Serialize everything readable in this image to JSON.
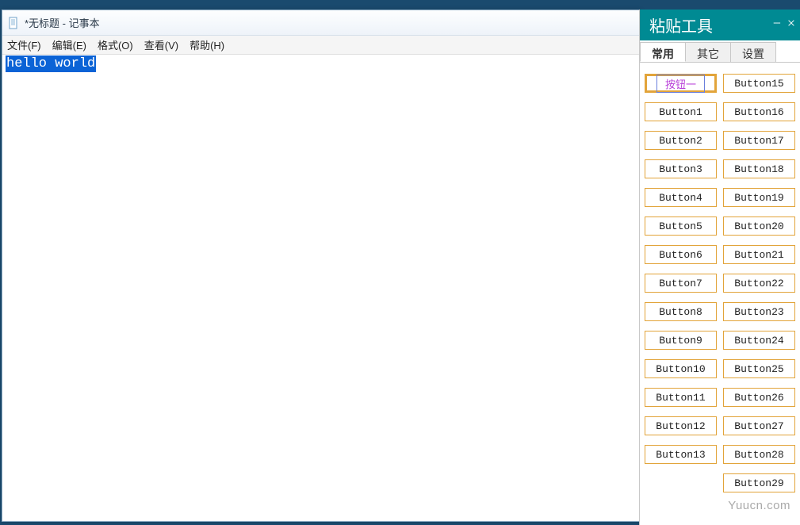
{
  "notepad": {
    "title": "*无标题 - 记事本",
    "menu": {
      "file": "文件(F)",
      "edit": "编辑(E)",
      "format": "格式(O)",
      "view": "查看(V)",
      "help": "帮助(H)"
    },
    "content_selected": "hello world"
  },
  "paste_tool": {
    "title": "粘贴工具",
    "tabs": {
      "common": "常用",
      "other": "其它",
      "settings": "设置"
    },
    "button_primary": "按钮一",
    "buttons_left": [
      "Button1",
      "Button2",
      "Button3",
      "Button4",
      "Button5",
      "Button6",
      "Button7",
      "Button8",
      "Button9",
      "Button10",
      "Button11",
      "Button12",
      "Button13"
    ],
    "buttons_right": [
      "Button15",
      "Button16",
      "Button17",
      "Button18",
      "Button19",
      "Button20",
      "Button21",
      "Button22",
      "Button23",
      "Button24",
      "Button25",
      "Button26",
      "Button27",
      "Button28",
      "Button29"
    ]
  },
  "watermark": "Yuucn.com"
}
